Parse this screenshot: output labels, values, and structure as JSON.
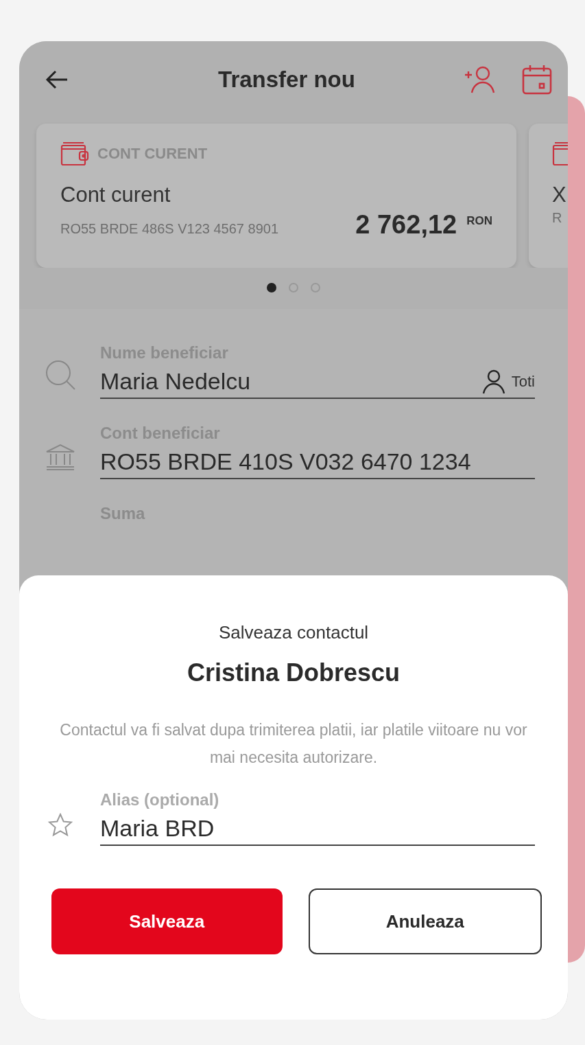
{
  "header": {
    "title": "Transfer nou"
  },
  "accounts": [
    {
      "type": "CONT CURENT",
      "name": "Cont curent",
      "iban": "RO55 BRDE 486S V123 4567 8901",
      "amount": "2 762,12",
      "currency": "RON"
    },
    {
      "name": "X",
      "iban": "R"
    }
  ],
  "pager": [
    {
      "selected": true
    },
    {
      "selected": false
    },
    {
      "selected": false
    }
  ],
  "fields": [
    {
      "kind": "search",
      "label": "Nume beneficiar",
      "value": "Maria Nedelcu",
      "action": "Toti"
    },
    {
      "kind": "bank",
      "label": "Cont beneficiar",
      "value": "RO55 BRDE 410S V032 6470 1234"
    },
    {
      "kind": "amount",
      "label": "Suma"
    }
  ],
  "sheet": {
    "subtitle": "Salveaza contactul",
    "title": "Cristina Dobrescu",
    "note": "Contactul va fi salvat dupa trimiterea platii, iar platile viitoare nu vor mai necesita autorizare.",
    "alias": {
      "label": "Alias (optional)",
      "value": "Maria BRD"
    },
    "buttons": [
      {
        "kind": "primary",
        "label": "Salveaza"
      },
      {
        "kind": "secondary",
        "label": "Anuleaza"
      }
    ]
  }
}
